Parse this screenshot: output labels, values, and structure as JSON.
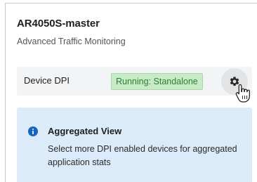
{
  "device": {
    "name": "AR4050S-master",
    "subtitle": "Advanced Traffic Monitoring"
  },
  "dpi_row": {
    "label": "Device DPI",
    "status": "Running: Standalone",
    "status_color": "#2e7d32",
    "status_bg": "#c8ebc7",
    "settings_icon": "gear-icon"
  },
  "info": {
    "icon": "info-circle-icon",
    "icon_color": "#1565c0",
    "title": "Aggregated View",
    "text": "Select more DPI enabled devices for aggregated application stats",
    "bg": "#dcebfa"
  },
  "cursor": "hand-pointer-cursor"
}
